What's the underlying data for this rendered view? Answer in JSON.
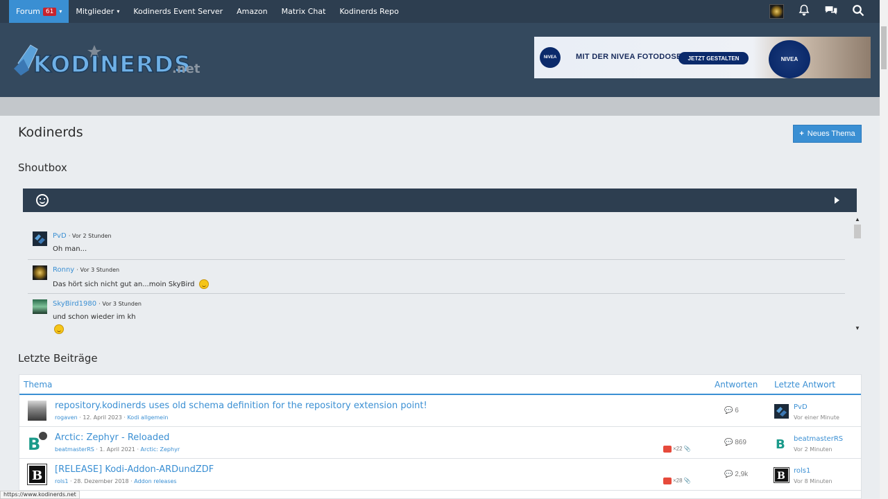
{
  "nav": {
    "items": [
      {
        "label": "Forum",
        "badge": "61"
      },
      {
        "label": "Mitglieder"
      },
      {
        "label": "Kodinerds Event Server"
      },
      {
        "label": "Amazon"
      },
      {
        "label": "Matrix Chat"
      },
      {
        "label": "Kodinerds Repo"
      }
    ]
  },
  "header": {
    "logo_text": "KODINERDS",
    "logo_suffix": ".net",
    "banner": {
      "brand": "NIVEA",
      "text": "MIT DER NIVEA FOTODOSE",
      "button": "JETZT GESTALTEN"
    }
  },
  "page": {
    "title": "Kodinerds",
    "new_thread": "Neues Thema"
  },
  "shoutbox": {
    "title": "Shoutbox",
    "messages": [
      {
        "user": "PvD",
        "time": "· Vor 2 Stunden",
        "text": "Oh man..."
      },
      {
        "user": "Ronny",
        "time": "· Vor 3 Stunden",
        "text": "Das hört sich nicht gut an...moin SkyBird"
      },
      {
        "user": "SkyBird1980",
        "time": "· Vor 3 Stunden",
        "text": "und schon wieder im kh"
      }
    ]
  },
  "recent": {
    "title": "Letzte Beiträge",
    "headers": {
      "topic": "Thema",
      "replies": "Antworten",
      "last": "Letzte Antwort"
    },
    "rows": [
      {
        "title": "repository.kodinerds uses old schema definition for the repository extension point!",
        "author": "rogaven",
        "date": "12. April 2023",
        "forum": "Kodi allgemein",
        "replies": "6",
        "likes": "",
        "last_user": "PvD",
        "last_time": "Vor einer Minute"
      },
      {
        "title": "Arctic: Zephyr - Reloaded",
        "author": "beatmasterRS",
        "date": "1. April 2021",
        "forum": "Arctic: Zephyr",
        "replies": "869",
        "likes": "×22",
        "last_user": "beatmasterRS",
        "last_time": "Vor 2 Minuten"
      },
      {
        "title": "[RELEASE] Kodi-Addon-ARDundZDF",
        "author": "rols1",
        "date": "28. Dezember 2018",
        "forum": "Addon releases",
        "replies": "2,9k",
        "likes": "×28",
        "last_user": "rols1",
        "last_time": "Vor 8 Minuten"
      }
    ]
  },
  "status_url": "https://www.kodinerds.net",
  "colors": {
    "nav": "#2d3e50",
    "accent": "#3a8fd3",
    "header": "#34495e"
  }
}
